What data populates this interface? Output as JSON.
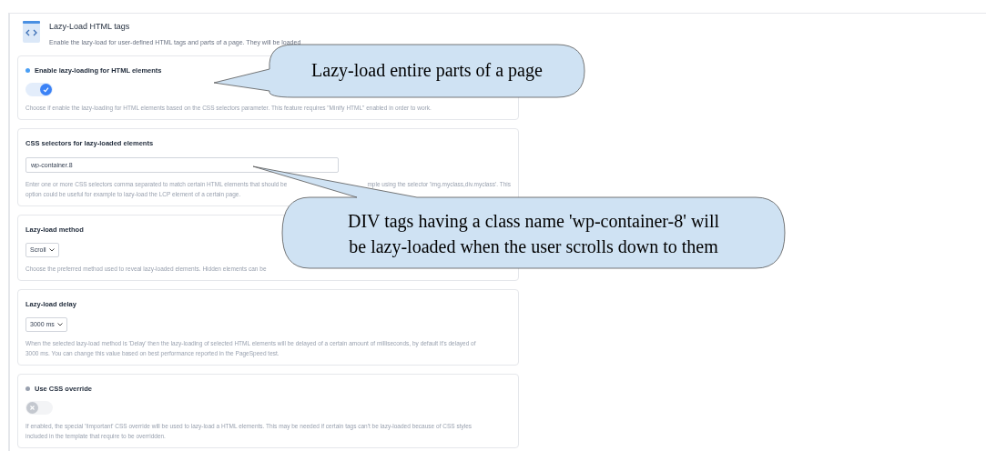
{
  "header": {
    "title": "Lazy-Load HTML tags",
    "description": "Enable the lazy-load for user-defined HTML tags and parts of a page. They will be loaded"
  },
  "cards": [
    {
      "kind": "toggle",
      "title": "Enable lazy-loading for HTML elements",
      "on": true,
      "description": [
        [
          "Choose if enable the lazy-loading for HTML elements based on the CSS selectors parameter. This feature requires \"Minify HTML\" enabled in order to work."
        ]
      ]
    },
    {
      "kind": "text",
      "title": "CSS selectors for lazy-loaded elements",
      "value": "wp-container.8",
      "description": [
        [
          "Enter one or more CSS selectors comma separated to match certain HTML elements that should be",
          "mple using the selector 'img.myclass,div.myclass'. This"
        ],
        [
          "option could be useful for example to lazy-load the LCP element of a certain page."
        ]
      ]
    },
    {
      "kind": "select",
      "title": "Lazy-load method",
      "value": "Scroll",
      "description": [
        [
          "Choose the preferred method used to reveal lazy-loaded elements. Hidden elements can be"
        ]
      ]
    },
    {
      "kind": "select",
      "title": "Lazy-load delay",
      "value": "3000 ms",
      "description": [
        [
          "When the selected lazy-load method is 'Delay' then the lazy-loading of selected HTML elements will be delayed of a certain amount of milliseconds, by default it's delayed of"
        ],
        [
          "3000 ms. You can change this value based on best performance reported in the PageSpeed test."
        ]
      ]
    },
    {
      "kind": "toggle",
      "title": "Use CSS override",
      "on": false,
      "description": [
        [
          "If enabled, the special '!important' CSS override will be used to lazy-load a HTML elements. This may be needed if certain tags can't be lazy-loaded because of CSS styles"
        ],
        [
          "included in the template that require to be overridden."
        ]
      ]
    }
  ],
  "callouts": [
    {
      "lines": [
        "Lazy-load entire parts of a page"
      ]
    },
    {
      "lines": [
        "DIV tags having a class name 'wp-container-8' will",
        "be lazy-loaded when the user scrolls down to them"
      ]
    }
  ]
}
